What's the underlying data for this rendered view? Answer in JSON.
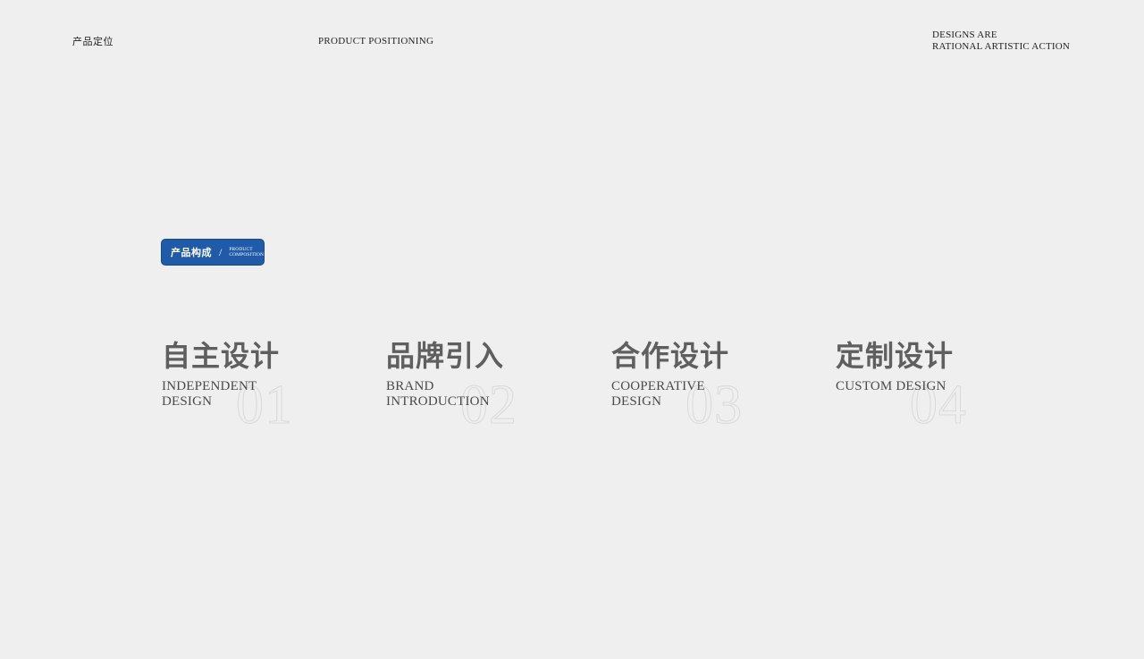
{
  "header": {
    "left_label": "产品定位",
    "center_label": "PRODUCT POSITIONING",
    "right_line1": "DESIGNS ARE",
    "right_line2": "RATIONAL ARTISTIC ACTION"
  },
  "badge": {
    "cn_label": "产品构成",
    "separator": "/",
    "en_line1": "PRODUCT",
    "en_line2": "COMPOSITION",
    "color": "#1f5ba8"
  },
  "items": [
    {
      "cn": "自主设计",
      "en_line1": "INDEPENDENT",
      "en_line2": "DESIGN",
      "number": "01"
    },
    {
      "cn": "品牌引入",
      "en_line1": "BRAND",
      "en_line2": "INTRODUCTION",
      "number": "02"
    },
    {
      "cn": "合作设计",
      "en_line1": "COOPERATIVE",
      "en_line2": "DESIGN",
      "number": "03"
    },
    {
      "cn": "定制设计",
      "en_line1": "CUSTOM DESIGN",
      "en_line2": "",
      "number": "04"
    }
  ]
}
